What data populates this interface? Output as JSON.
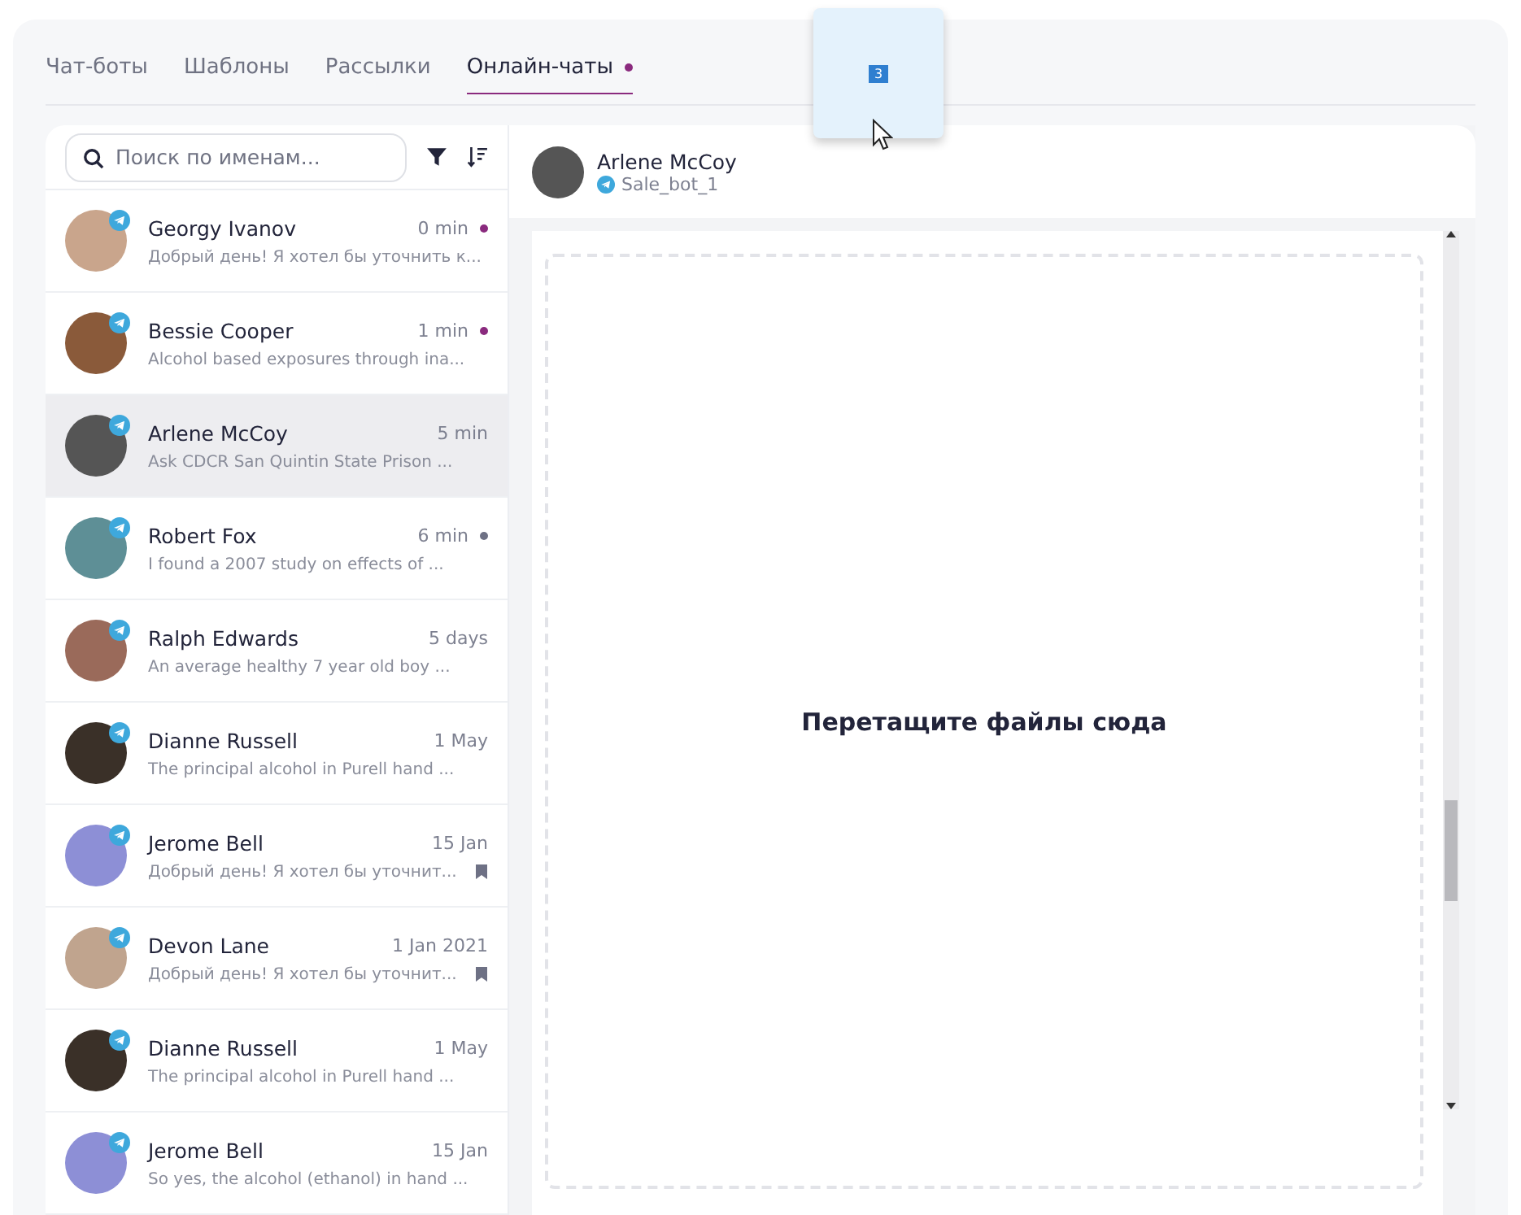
{
  "tabs": [
    {
      "label": "Чат-боты",
      "selected": false,
      "badge": false
    },
    {
      "label": "Шаблоны",
      "selected": false,
      "badge": false
    },
    {
      "label": "Рассылки",
      "selected": false,
      "badge": false
    },
    {
      "label": "Онлайн-чаты",
      "selected": true,
      "badge": true
    }
  ],
  "drag_preview": {
    "count": "3"
  },
  "search": {
    "placeholder": "Поиск по именам..."
  },
  "chats": [
    {
      "name": "Georgy Ivanov",
      "time": "0 min",
      "preview": "Добрый день! Я хотел бы уточнить к...",
      "selected": false,
      "color": "#8a2a7e",
      "pinned": false
    },
    {
      "name": "Bessie Cooper",
      "time": "1 min",
      "preview": "Alcohol based exposures through ina...",
      "selected": false,
      "color": "#8a2a7e",
      "pinned": false
    },
    {
      "name": "Arlene McCoy",
      "time": "5 min",
      "preview": "Ask CDCR San Quintin State Prison ...",
      "selected": true,
      "pinned": false
    },
    {
      "name": "Robert Fox",
      "time": "6 min",
      "preview": "I found a 2007 study on effects of ...",
      "selected": false,
      "color": "#6e7185",
      "pinned": false
    },
    {
      "name": "Ralph Edwards",
      "time": "5 days",
      "preview": "An average healthy 7 year old boy ...",
      "selected": false,
      "pinned": false
    },
    {
      "name": "Dianne Russell",
      "time": "1 May",
      "preview": "The principal alcohol in Purell hand ...",
      "selected": false,
      "pinned": false
    },
    {
      "name": "Jerome Bell",
      "time": "15 Jan",
      "preview": "Добрый день! Я хотел бы уточнит...",
      "selected": false,
      "pinned": true
    },
    {
      "name": "Devon Lane",
      "time": "1 Jan 2021",
      "preview": "Добрый день! Я хотел бы уточнит...",
      "selected": false,
      "pinned": true
    },
    {
      "name": "Dianne Russell",
      "time": "1 May",
      "preview": "The principal alcohol in Purell hand ...",
      "selected": false,
      "pinned": false
    },
    {
      "name": "Jerome Bell",
      "time": "15 Jan",
      "preview": "So yes, the alcohol (ethanol) in hand ...",
      "selected": false,
      "pinned": false
    }
  ],
  "conversation": {
    "name": "Arlene McCoy",
    "bot": "Sale_bot_1"
  },
  "dropzone": {
    "text": "Перетащите файлы сюда"
  }
}
